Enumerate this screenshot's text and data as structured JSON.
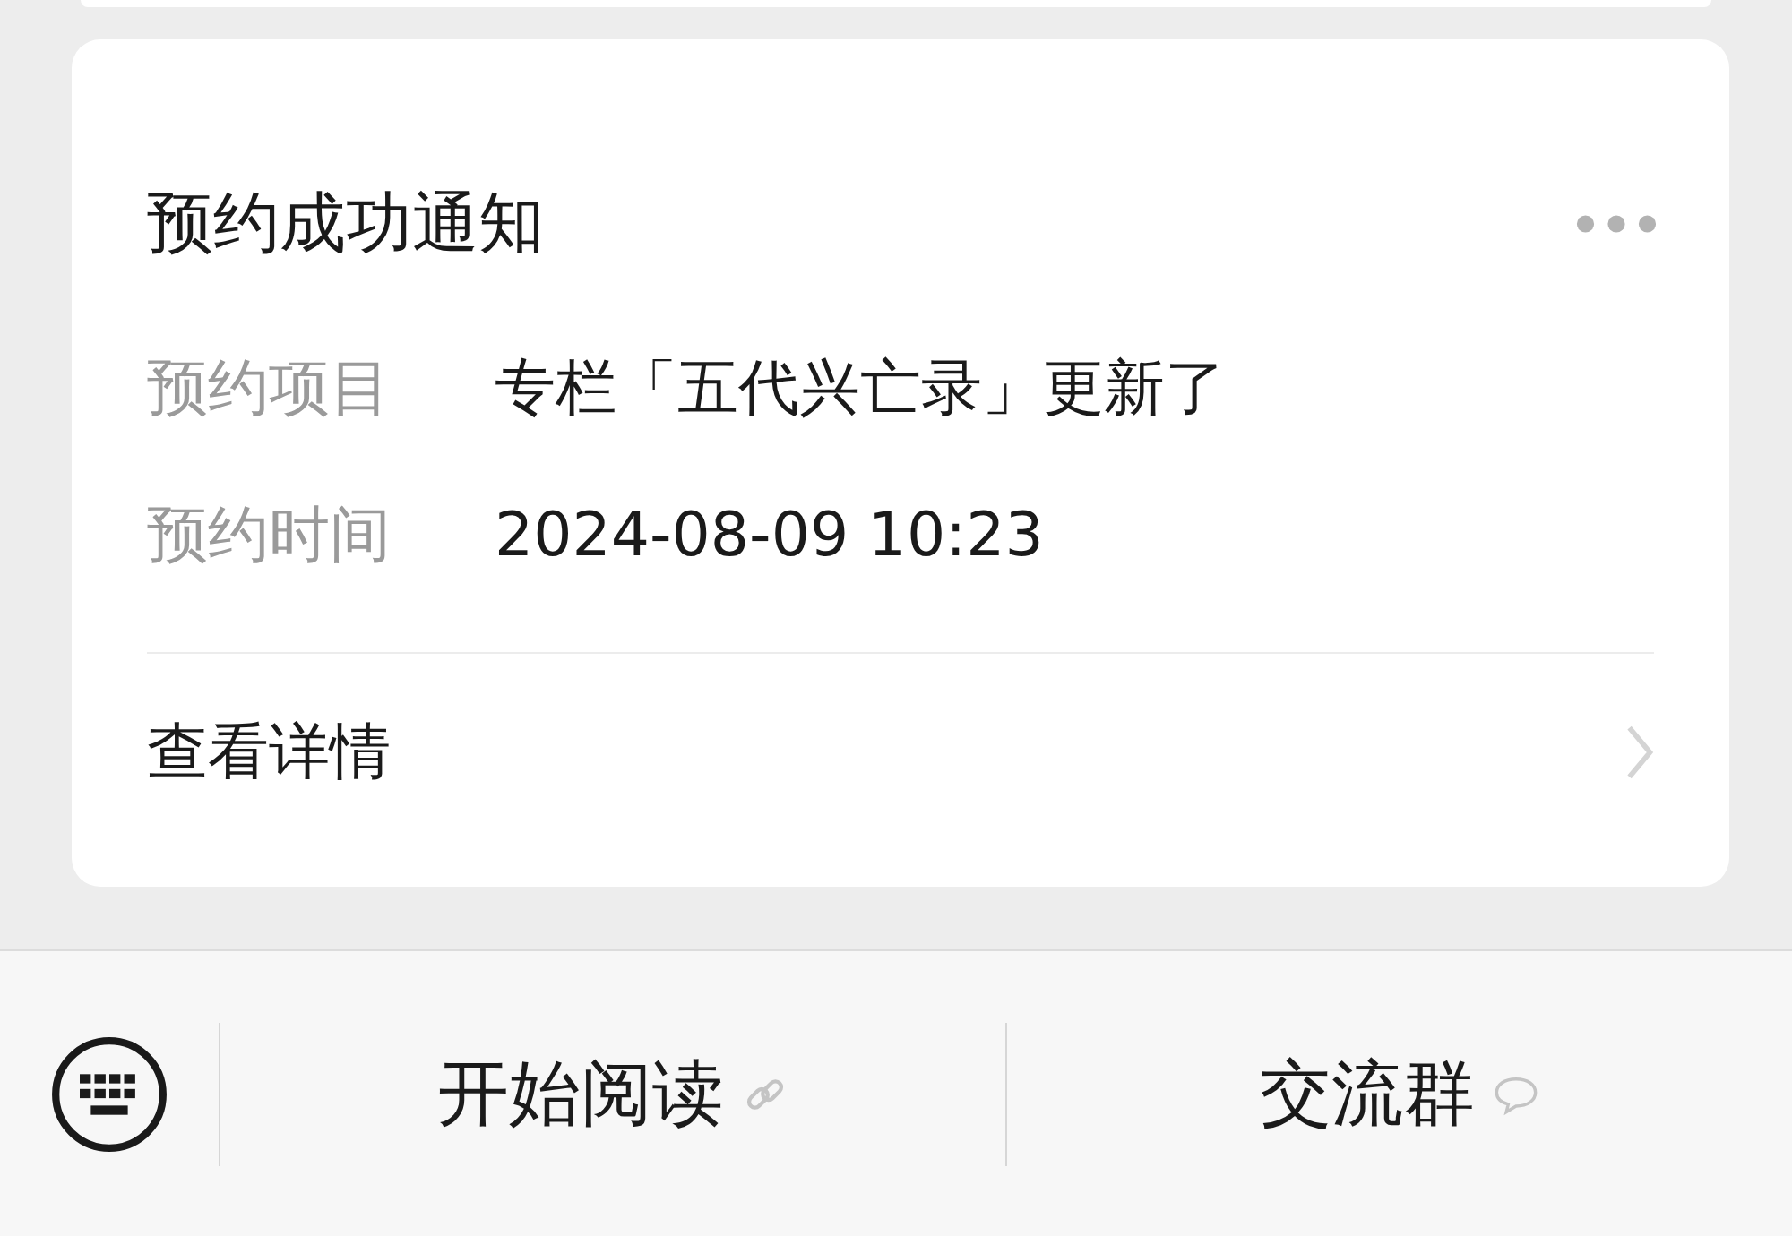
{
  "card": {
    "title": "预约成功通知",
    "fields": [
      {
        "label": "预约项目",
        "value": "专栏「五代兴亡录」更新了"
      },
      {
        "label": "预约时间",
        "value": "2024-08-09 10:23"
      }
    ],
    "link": "查看详情"
  },
  "bottom_menu": [
    {
      "label": "开始阅读",
      "kind": "link"
    },
    {
      "label": "交流群",
      "kind": "chat"
    }
  ]
}
